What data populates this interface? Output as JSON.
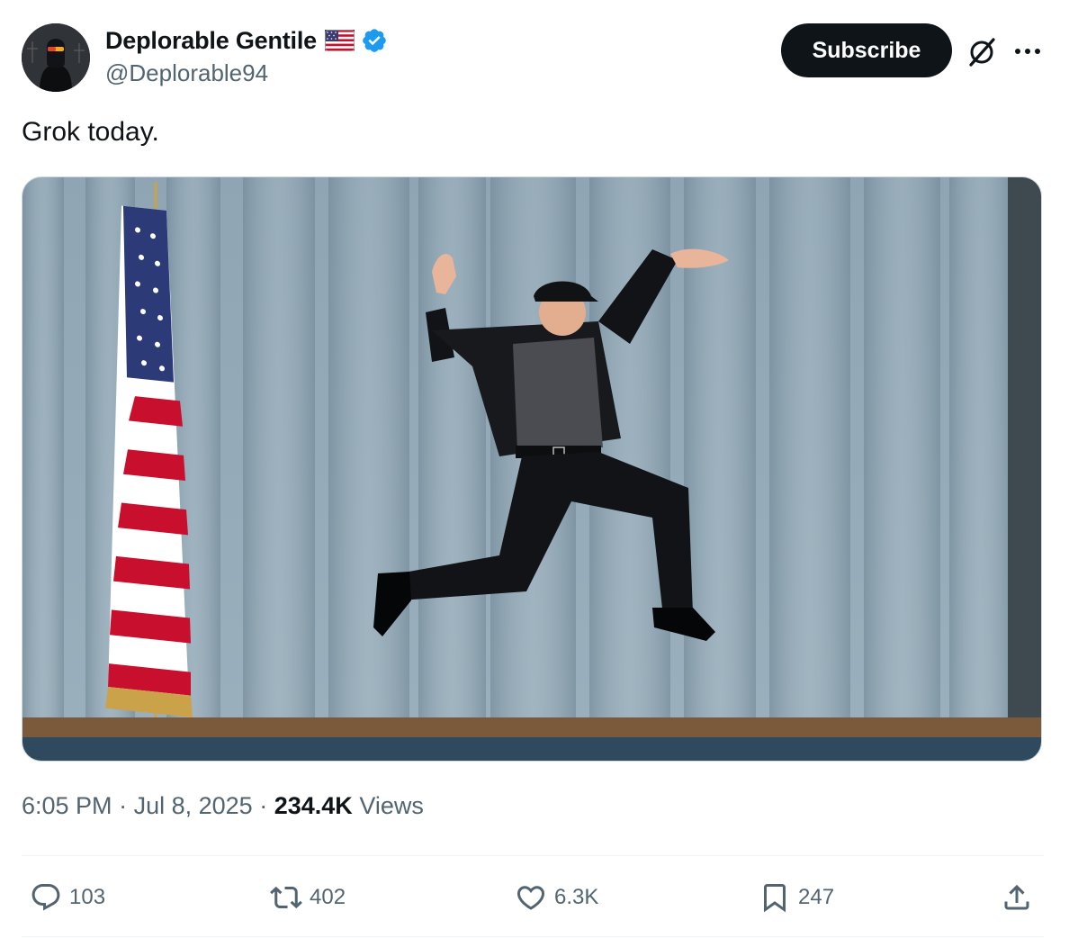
{
  "author": {
    "display_name": "Deplorable Gentile",
    "handle": "@Deplorable94",
    "badge_icon": "verified-badge-icon",
    "flag_icon": "us-flag-icon",
    "verified_color": "#1d9bf0"
  },
  "header": {
    "subscribe_label": "Subscribe",
    "grok_icon": "grok-icon",
    "more_icon": "more-icon"
  },
  "tweet": {
    "text": "Grok today."
  },
  "meta": {
    "time": "6:05 PM",
    "date": "Jul 8, 2025",
    "views_count": "234.4K",
    "views_label": "Views",
    "separator": "·"
  },
  "actions": {
    "replies": "103",
    "reposts": "402",
    "likes": "6.3K",
    "bookmarks": "247"
  },
  "colors": {
    "text_primary": "#0f1419",
    "text_secondary": "#536471",
    "button_bg": "#0f1419"
  }
}
